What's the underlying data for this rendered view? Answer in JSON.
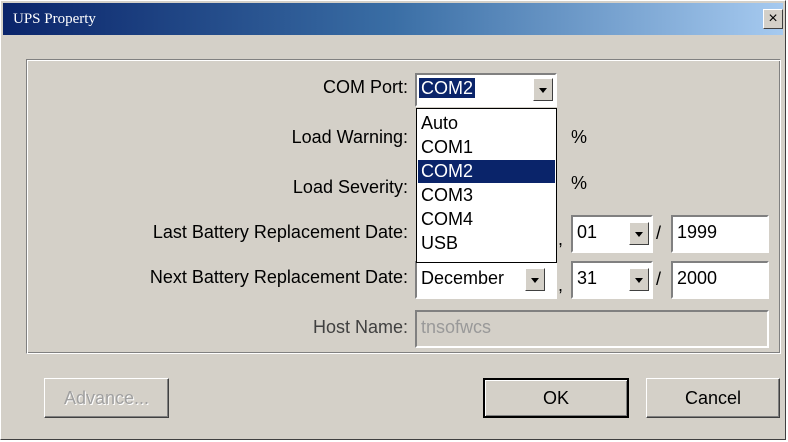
{
  "window": {
    "title": "UPS Property",
    "close_glyph": "×"
  },
  "form": {
    "com_port": {
      "label": "COM Port:",
      "value": "COM2",
      "options": [
        "Auto",
        "COM1",
        "COM2",
        "COM3",
        "COM4",
        "USB"
      ],
      "selected_index": 2
    },
    "load_warning": {
      "label": "Load Warning:",
      "unit": "%"
    },
    "load_severity": {
      "label": "Load Severity:",
      "unit": "%"
    },
    "last_battery": {
      "label": "Last Battery Replacement Date:",
      "day": "01",
      "year": "1999"
    },
    "next_battery": {
      "label": "Next Battery Replacement Date:",
      "month": "December",
      "day": "31",
      "year": "2000"
    },
    "host_name": {
      "label": "Host Name:",
      "value": "tnsofwcs"
    },
    "date_separator": "/",
    "comma": ","
  },
  "buttons": {
    "advance": "Advance...",
    "ok": "OK",
    "cancel": "Cancel"
  },
  "icons": {
    "dropdown": "chevron-down-icon",
    "close": "close-icon"
  }
}
